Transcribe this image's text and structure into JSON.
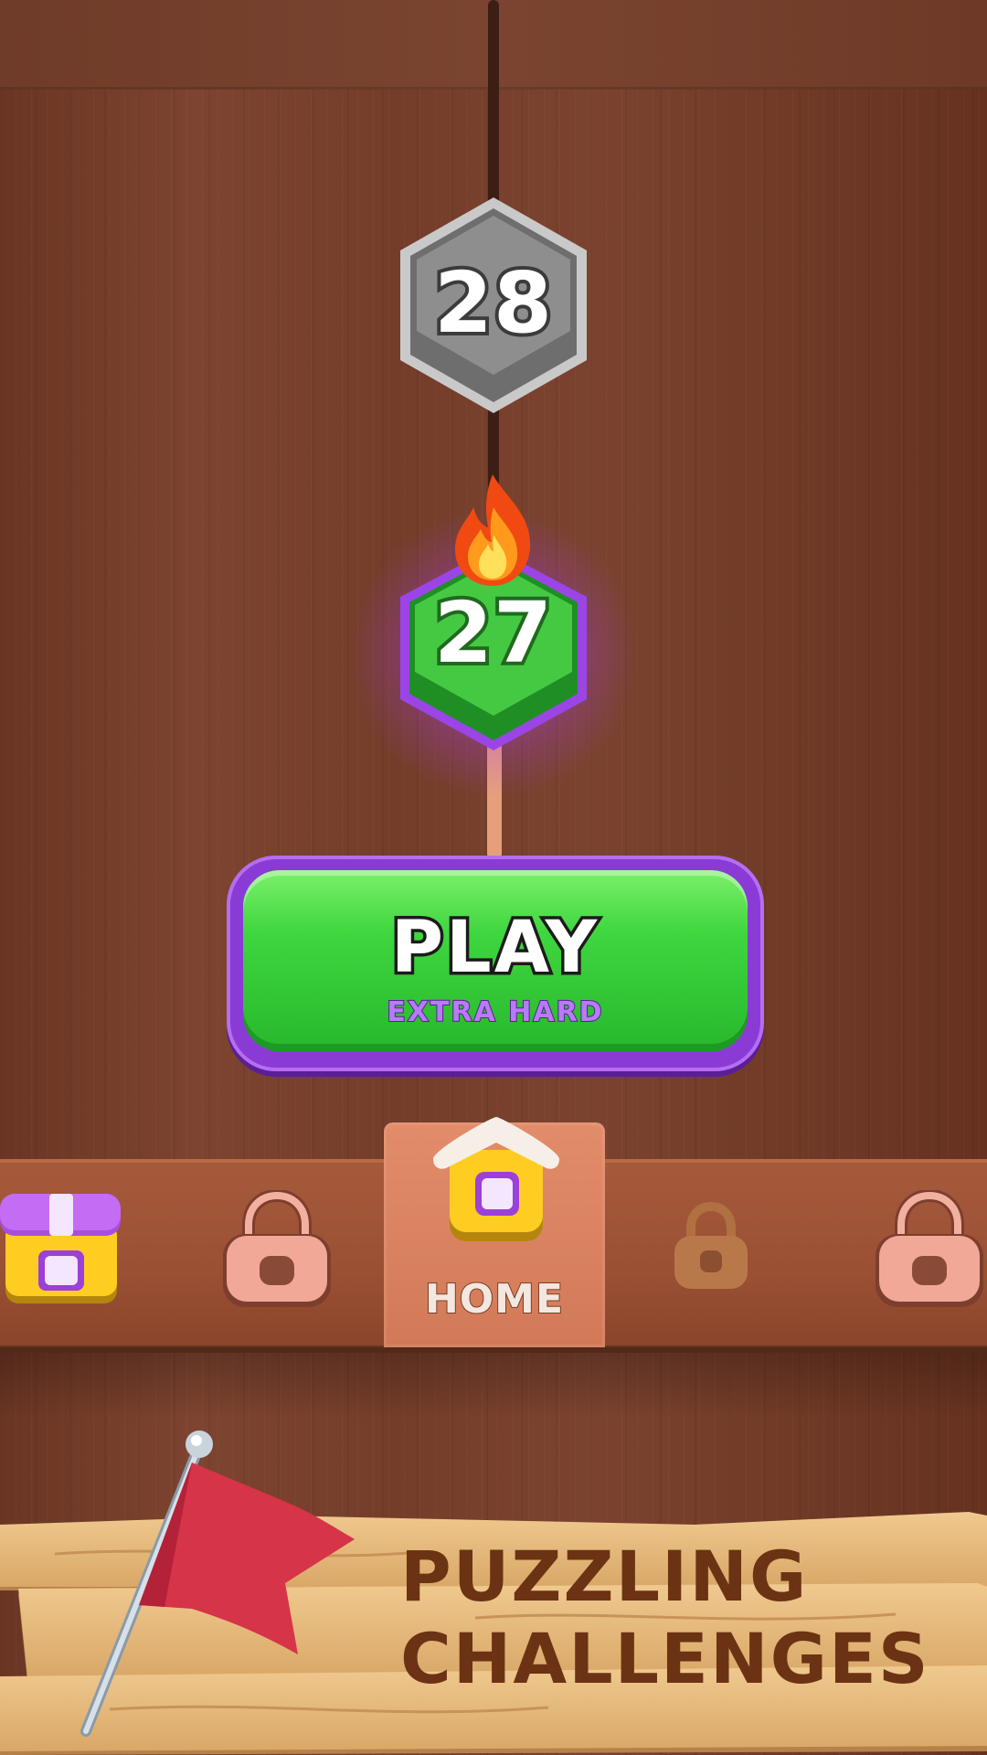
{
  "levels": {
    "locked_next": "28",
    "current": "27"
  },
  "play_button": {
    "label": "PLAY",
    "difficulty": "EXTRA HARD"
  },
  "nav": {
    "home_label": "HOME",
    "items": [
      {
        "icon": "shop-icon",
        "state": "available"
      },
      {
        "icon": "lock-icon",
        "state": "locked"
      },
      {
        "icon": "home-icon",
        "state": "selected"
      },
      {
        "icon": "lock-icon",
        "state": "locked"
      },
      {
        "icon": "lock-icon",
        "state": "locked"
      }
    ]
  },
  "banner": {
    "line1": "PUZZLING",
    "line2": "CHALLENGES"
  },
  "colors": {
    "play_green": "#3fd63f",
    "accent_purple": "#8a3bd6",
    "locked_gray": "#8a8a8a",
    "banner_text": "#6b3313"
  }
}
